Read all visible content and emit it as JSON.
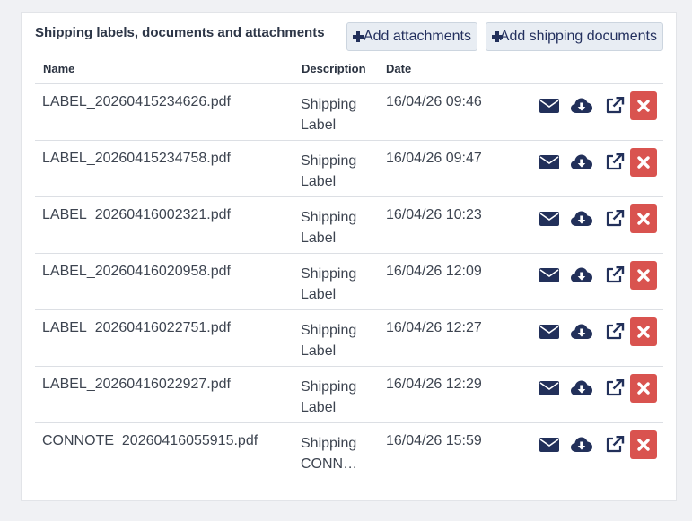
{
  "panel": {
    "title": "Shipping labels, documents and attachments",
    "add_attachments_label": "Add attachments",
    "add_shipping_documents_label": "Add shipping documents"
  },
  "table": {
    "columns": [
      "Name",
      "Description",
      "Date"
    ],
    "rows": [
      {
        "name": "LABEL_20260415234626.pdf",
        "desc_line1": "Shipping",
        "desc_line2": "Label",
        "date": "16/04/26 09:46"
      },
      {
        "name": "LABEL_20260415234758.pdf",
        "desc_line1": "Shipping",
        "desc_line2": "Label",
        "date": "16/04/26 09:47"
      },
      {
        "name": "LABEL_20260416002321.pdf",
        "desc_line1": "Shipping",
        "desc_line2": "Label",
        "date": "16/04/26 10:23"
      },
      {
        "name": "LABEL_20260416020958.pdf",
        "desc_line1": "Shipping",
        "desc_line2": "Label",
        "date": "16/04/26 12:09"
      },
      {
        "name": "LABEL_20260416022751.pdf",
        "desc_line1": "Shipping",
        "desc_line2": "Label",
        "date": "16/04/26 12:27"
      },
      {
        "name": "LABEL_20260416022927.pdf",
        "desc_line1": "Shipping",
        "desc_line2": "Label",
        "date": "16/04/26 12:29"
      },
      {
        "name": "CONNOTE_20260416055915.pdf",
        "desc_line1": "Shipping",
        "desc_line2": "CONNOTE",
        "date": "16/04/26 15:59"
      }
    ],
    "row_actions": [
      "envelope-icon",
      "cloud-download-icon",
      "external-link-icon",
      "delete-icon"
    ]
  },
  "colors": {
    "icon": "#22305a",
    "delete_bg": "#d9534f",
    "button_bg": "#e8edf3"
  }
}
